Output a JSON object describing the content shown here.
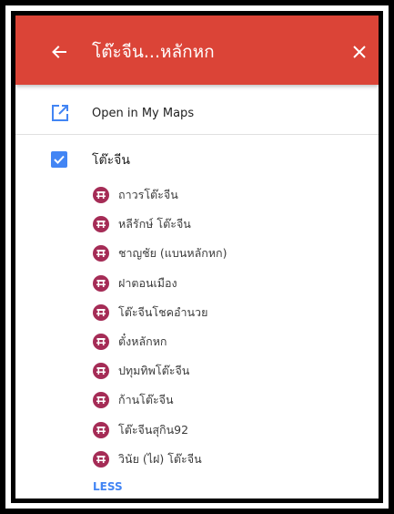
{
  "header": {
    "title": "โต๊ะจีน...หลักหก",
    "back_icon": "arrow-back-icon",
    "close_icon": "close-icon",
    "background_color": "#db4437"
  },
  "open_in_my_maps": {
    "label": "Open in My Maps",
    "icon": "open-in-new-icon",
    "icon_color": "#4285f4"
  },
  "layer": {
    "label": "โต๊ะจีน",
    "checked": true,
    "checkbox_color": "#4285f4"
  },
  "places": [
    {
      "label": "ถาวรโต๊ะจีน",
      "icon": "table-pin-icon"
    },
    {
      "label": "หลีรักษ์ โต๊ะจีน",
      "icon": "table-pin-icon"
    },
    {
      "label": "ชาญชัย (แบนหลักหก)",
      "icon": "table-pin-icon"
    },
    {
      "label": "ฝาตอนเมือง",
      "icon": "table-pin-icon"
    },
    {
      "label": "โต๊ะจีนโชคอำนวย",
      "icon": "table-pin-icon"
    },
    {
      "label": "ตั๋งหลักหก",
      "icon": "table-pin-icon"
    },
    {
      "label": "ปทุมทิพโต๊ะจีน",
      "icon": "table-pin-icon"
    },
    {
      "label": "ก้านโต๊ะจีน",
      "icon": "table-pin-icon"
    },
    {
      "label": "โต๊ะจีนสุกิน92",
      "icon": "table-pin-icon"
    },
    {
      "label": "วินัย (ไฝ) โต๊ะจีน",
      "icon": "table-pin-icon"
    }
  ],
  "place_icon_color": "#a52c56",
  "less_label": "LESS"
}
